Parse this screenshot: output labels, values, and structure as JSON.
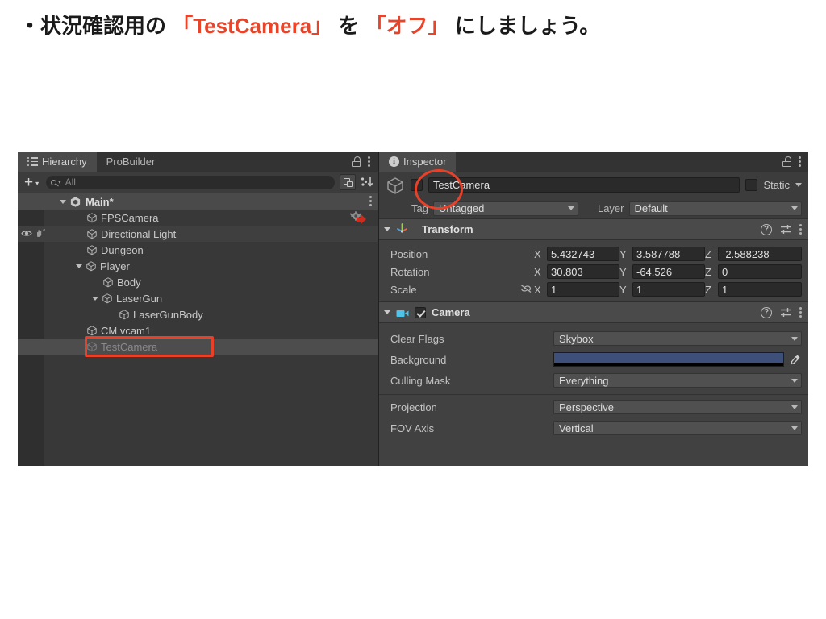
{
  "caption": {
    "prefix": "・状況確認用の ",
    "hl1": "「TestCamera」",
    "mid": " を ",
    "hl2": "「オフ」",
    "suffix": " にしましょう。"
  },
  "hierarchy": {
    "tabs": [
      {
        "label": "Hierarchy",
        "active": true,
        "icon": "hierarchy-list-icon"
      },
      {
        "label": "ProBuilder",
        "active": false
      }
    ],
    "toolbar": {
      "create_label": "+",
      "create_caret": "▾",
      "search_placeholder": "All",
      "search_value": "",
      "search_icon": "magnifier-icon",
      "window_icon": "open-in-window-icon",
      "sort_icon": "sort-alpha-icon"
    },
    "lock_icon": "lock-icon",
    "menu_icon": "kebab-menu-icon",
    "tree": [
      {
        "label": "Main*",
        "depth": 0,
        "type": "scene",
        "foldout": "open",
        "selected": false,
        "disabled": false,
        "kebab": true
      },
      {
        "label": "FPSCamera",
        "depth": 1,
        "type": "gameobject",
        "foldout": "none",
        "selected": false,
        "disabled": false,
        "badge": "prefab-modified-icon"
      },
      {
        "label": "Directional Light",
        "depth": 1,
        "type": "gameobject",
        "foldout": "none",
        "selected": false,
        "disabled": false,
        "hover": true,
        "visibility": true
      },
      {
        "label": "Dungeon",
        "depth": 1,
        "type": "gameobject",
        "foldout": "none",
        "selected": false,
        "disabled": false
      },
      {
        "label": "Player",
        "depth": 1,
        "type": "gameobject",
        "foldout": "open",
        "selected": false,
        "disabled": false
      },
      {
        "label": "Body",
        "depth": 2,
        "type": "gameobject",
        "foldout": "none",
        "selected": false,
        "disabled": false
      },
      {
        "label": "LaserGun",
        "depth": 2,
        "type": "gameobject",
        "foldout": "open",
        "selected": false,
        "disabled": false
      },
      {
        "label": "LaserGunBody",
        "depth": 3,
        "type": "gameobject",
        "foldout": "none",
        "selected": false,
        "disabled": false
      },
      {
        "label": "CM vcam1",
        "depth": 1,
        "type": "gameobject",
        "foldout": "none",
        "selected": false,
        "disabled": false
      },
      {
        "label": "TestCamera",
        "depth": 1,
        "type": "gameobject",
        "foldout": "none",
        "selected": true,
        "disabled": true,
        "annotated": true
      }
    ]
  },
  "inspector": {
    "tab": {
      "label": "Inspector",
      "icon": "info-icon"
    },
    "lock_icon": "lock-icon",
    "menu_icon": "kebab-menu-icon",
    "object": {
      "icon": "gameobject-cube-icon",
      "active": false,
      "name": "TestCamera",
      "static_label": "Static",
      "static_checked": false
    },
    "tag_label": "Tag",
    "tag_value": "Untagged",
    "layer_label": "Layer",
    "layer_value": "Default",
    "transform": {
      "title": "Transform",
      "icon": "transform-axis-icon",
      "expanded": true,
      "help_icon": "help-icon",
      "preset_icon": "preset-sliders-icon",
      "menu_icon": "kebab-menu-icon",
      "rows": [
        {
          "label": "Position",
          "x": "5.432743",
          "y": "3.587788",
          "z": "-2.588238"
        },
        {
          "label": "Rotation",
          "x": "30.803",
          "y": "-64.526",
          "z": "0"
        },
        {
          "label": "Scale",
          "x": "1",
          "y": "1",
          "z": "1",
          "link_icon": "constrain-proportions-off-icon"
        }
      ],
      "axes": [
        "X",
        "Y",
        "Z"
      ]
    },
    "camera": {
      "title": "Camera",
      "icon": "camera-icon",
      "enabled": true,
      "expanded": true,
      "help_icon": "help-icon",
      "preset_icon": "preset-sliders-icon",
      "menu_icon": "kebab-menu-icon",
      "props": [
        {
          "label": "Clear Flags",
          "value": "Skybox",
          "kind": "dropdown"
        },
        {
          "label": "Background",
          "value": "#3e4f7a",
          "kind": "color",
          "eyedropper_icon": "eyedropper-icon"
        },
        {
          "label": "Culling Mask",
          "value": "Everything",
          "kind": "dropdown"
        },
        {
          "label": "Projection",
          "value": "Perspective",
          "kind": "dropdown"
        },
        {
          "label": "FOV Axis",
          "value": "Vertical",
          "kind": "dropdown"
        }
      ]
    }
  },
  "colors": {
    "accent_red": "#e8412a",
    "background_swatch": "#3e4f7a"
  }
}
